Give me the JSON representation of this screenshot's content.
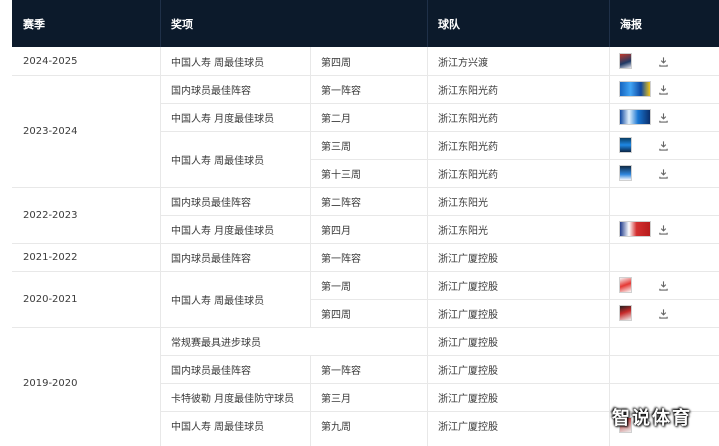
{
  "table": {
    "headers": {
      "season": "赛季",
      "award": "奖项",
      "team": "球队",
      "poster": "海报"
    },
    "season_groups": [
      "2024-2025",
      "2023-2024",
      "2022-2023",
      "2021-2022",
      "2020-2021",
      "2019-2020"
    ],
    "award_groups": [
      "中国人寿 周最佳球员",
      "国内球员最佳阵容",
      "中国人寿 月度最佳球员",
      "中国人寿 周最佳球员",
      "国内球员最佳阵容",
      "中国人寿 月度最佳球员",
      "国内球员最佳阵容",
      "中国人寿 周最佳球员",
      "常规赛最具进步球员",
      "国内球员最佳阵容",
      "卡特彼勒 月度最佳防守球员",
      "中国人寿 周最佳球员"
    ],
    "rows": [
      {
        "detail": "第四周",
        "team": "浙江方兴渡"
      },
      {
        "detail": "第一阵容",
        "team": "浙江东阳光药"
      },
      {
        "detail": "第二月",
        "team": "浙江东阳光药"
      },
      {
        "detail": "第三周",
        "team": "浙江东阳光药"
      },
      {
        "detail": "第十三周",
        "team": "浙江东阳光药"
      },
      {
        "detail": "第二阵容",
        "team": "浙江东阳光"
      },
      {
        "detail": "第四月",
        "team": "浙江东阳光"
      },
      {
        "detail": "第一阵容",
        "team": "浙江广厦控股"
      },
      {
        "detail": "第一周",
        "team": "浙江广厦控股"
      },
      {
        "detail": "第四周",
        "team": "浙江广厦控股"
      },
      {
        "detail": "",
        "team": "浙江广厦控股"
      },
      {
        "detail": "第一阵容",
        "team": "浙江广厦控股"
      },
      {
        "detail": "第三月",
        "team": "浙江广厦控股"
      },
      {
        "detail": "第九周",
        "team": "浙江广厦控股"
      }
    ],
    "poster_icons": [
      "poster-thumbnail-icon",
      "download-icon"
    ]
  },
  "watermark": "智说体育",
  "colors": {
    "header_bg": "#0c1a2b",
    "header_text": "#ffffff",
    "grid": "#e8e8e8",
    "text": "#3a3a3a"
  }
}
